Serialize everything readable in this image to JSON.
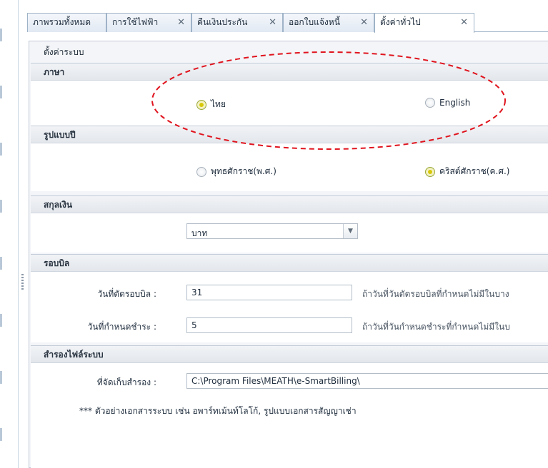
{
  "tabs": [
    {
      "label": "ภาพรวมทั้งหมด",
      "closable": false
    },
    {
      "label": "การใช้ไฟฟ้า",
      "closable": true
    },
    {
      "label": "คืนเงินประกัน",
      "closable": true
    },
    {
      "label": "ออกใบแจ้งหนี้",
      "closable": true
    },
    {
      "label": "ตั้งค่าทั่วไป",
      "closable": true,
      "active": true
    }
  ],
  "close_glyph": "✕",
  "panel": {
    "title": "ตั้งค่าระบบ"
  },
  "language": {
    "header": "ภาษา",
    "options": [
      {
        "label": "ไทย",
        "checked": true
      },
      {
        "label": "English",
        "checked": false
      }
    ]
  },
  "year_format": {
    "header": "รูปแบบปี",
    "options": [
      {
        "label": "พุทธศักราช(พ.ศ.)",
        "checked": false
      },
      {
        "label": "คริสต์ศักราช(ค.ศ.)",
        "checked": true
      }
    ]
  },
  "currency": {
    "header": "สกุลเงิน",
    "value": "บาท"
  },
  "billing": {
    "header": "รอบบิล",
    "cutoff_label": "วันที่ตัดรอบบิล :",
    "cutoff_value": "31",
    "cutoff_hint": "ถ้าวันที่วันตัดรอบบิลที่กำหนดไม่มีในบาง",
    "due_label": "วันที่กำหนดชำระ :",
    "due_value": "5",
    "due_hint": "ถ้าวันที่วันกำหนดชำระที่กำหนดไม่มีในบ"
  },
  "backup": {
    "header": "สำรองไฟล์ระบบ",
    "path_label": "ที่จัดเก็บสำรอง :",
    "path_value": "C:\\Program Files\\MEATH\\e-SmartBilling\\",
    "note": "*** ตัวอย่างเอกสารระบบ เช่น อพาร์ทเม้นท์โลโก้, รูปแบบเอกสารสัญญาเช่า"
  },
  "colors": {
    "annotation": "#e0141e",
    "radio_checked": "#d7c70a",
    "tab_border": "#9fb3c8"
  }
}
